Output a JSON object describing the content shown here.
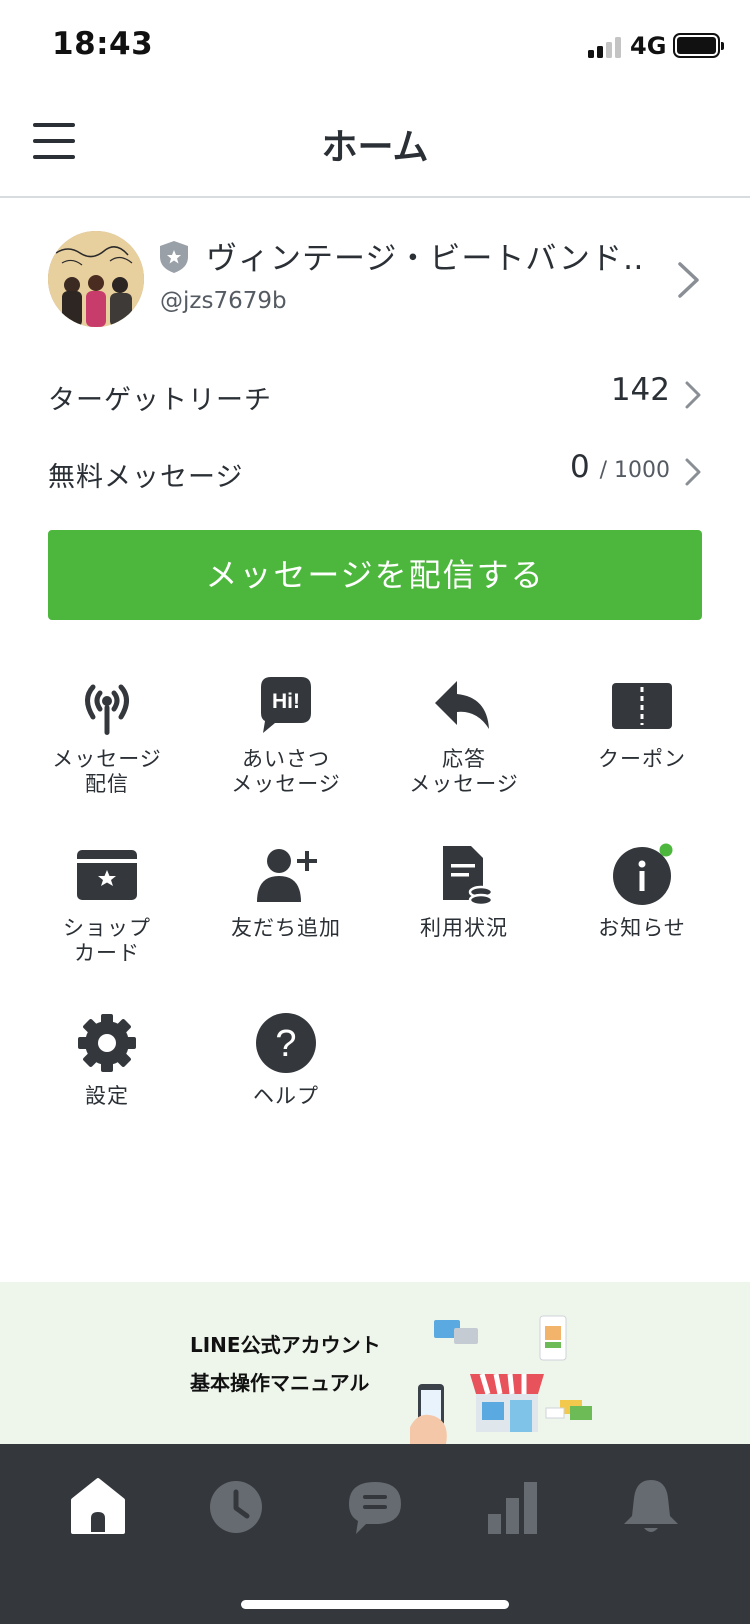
{
  "status_bar": {
    "time": "18:43",
    "network": "4G"
  },
  "nav": {
    "title": "ホーム"
  },
  "profile": {
    "name": "ヴィンテージ・ビートバンド…",
    "id": "@jzs7679b"
  },
  "stats": [
    {
      "label": "ターゲットリーチ",
      "value": "142"
    },
    {
      "label": "無料メッセージ",
      "value": "0",
      "limit": "/ 1000"
    }
  ],
  "cta": {
    "label": "メッセージを配信する"
  },
  "menu": [
    {
      "label": "メッセージ\n配信",
      "icon": "broadcast-icon"
    },
    {
      "label": "あいさつ\nメッセージ",
      "icon": "hi-greeting-icon"
    },
    {
      "label": "応答\nメッセージ",
      "icon": "reply-arrow-icon"
    },
    {
      "label": "クーポン",
      "icon": "coupon-icon"
    },
    {
      "label": "ショップ\nカード",
      "icon": "shop-card-icon"
    },
    {
      "label": "友だち追加",
      "icon": "add-friend-icon"
    },
    {
      "label": "利用状況",
      "icon": "usage-icon"
    },
    {
      "label": "お知らせ",
      "icon": "info-icon"
    },
    {
      "label": "設定",
      "icon": "gear-icon"
    },
    {
      "label": "ヘルプ",
      "icon": "help-icon"
    }
  ],
  "banner": {
    "line1": "LINE公式アカウント",
    "line2": "基本操作マニュアル"
  },
  "tabs": [
    {
      "icon": "home-icon",
      "active": true
    },
    {
      "icon": "clock-icon",
      "active": false
    },
    {
      "icon": "chat-icon",
      "active": false
    },
    {
      "icon": "bar-chart-icon",
      "active": false
    },
    {
      "icon": "bell-icon",
      "active": false
    }
  ],
  "colors": {
    "accent": "#4cb73c",
    "text": "#2b3036",
    "tab_bar": "#34383d",
    "banner_bg": "#eef6ec",
    "notification_dot": "#4cb73c"
  }
}
